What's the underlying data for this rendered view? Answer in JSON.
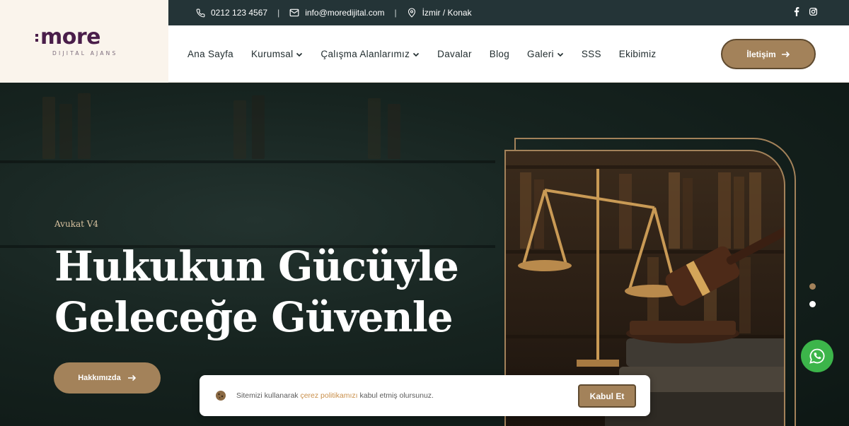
{
  "logo": {
    "word": "more",
    "subtitle": "DIJITAL AJANS"
  },
  "topbar": {
    "phone": "0212 123 4567",
    "email": "info@moredijital.com",
    "location": "İzmir / Konak",
    "separator": "|",
    "icons": [
      "phone-icon",
      "mail-icon",
      "location-pin-icon",
      "facebook-icon",
      "instagram-icon"
    ]
  },
  "nav": {
    "items": [
      {
        "label": "Ana Sayfa",
        "dropdown": false
      },
      {
        "label": "Kurumsal",
        "dropdown": true
      },
      {
        "label": "Çalışma Alanlarımız",
        "dropdown": true
      },
      {
        "label": "Davalar",
        "dropdown": false
      },
      {
        "label": "Blog",
        "dropdown": false
      },
      {
        "label": "Galeri",
        "dropdown": true
      },
      {
        "label": "SSS",
        "dropdown": false
      },
      {
        "label": "Ekibimiz",
        "dropdown": false
      }
    ],
    "contact_label": "İletişim"
  },
  "hero": {
    "eyebrow": "Avukat V4",
    "title_line1": "Hukukun Gücüyle",
    "title_line2": "Geleceğe Güvenle",
    "button_label": "Hakkımızda"
  },
  "slider": {
    "slides": 2,
    "active": 1
  },
  "cookie": {
    "text_before": "Sitemizi kullanarak ",
    "link": "çerez politikamızı",
    "text_after": " kabul etmiş olursunuz.",
    "accept_label": "Kabul Et"
  },
  "colors": {
    "accent": "#a3825a",
    "topbar": "#243437",
    "logo": "#4a1e4a",
    "whatsapp": "#3cb54a"
  }
}
